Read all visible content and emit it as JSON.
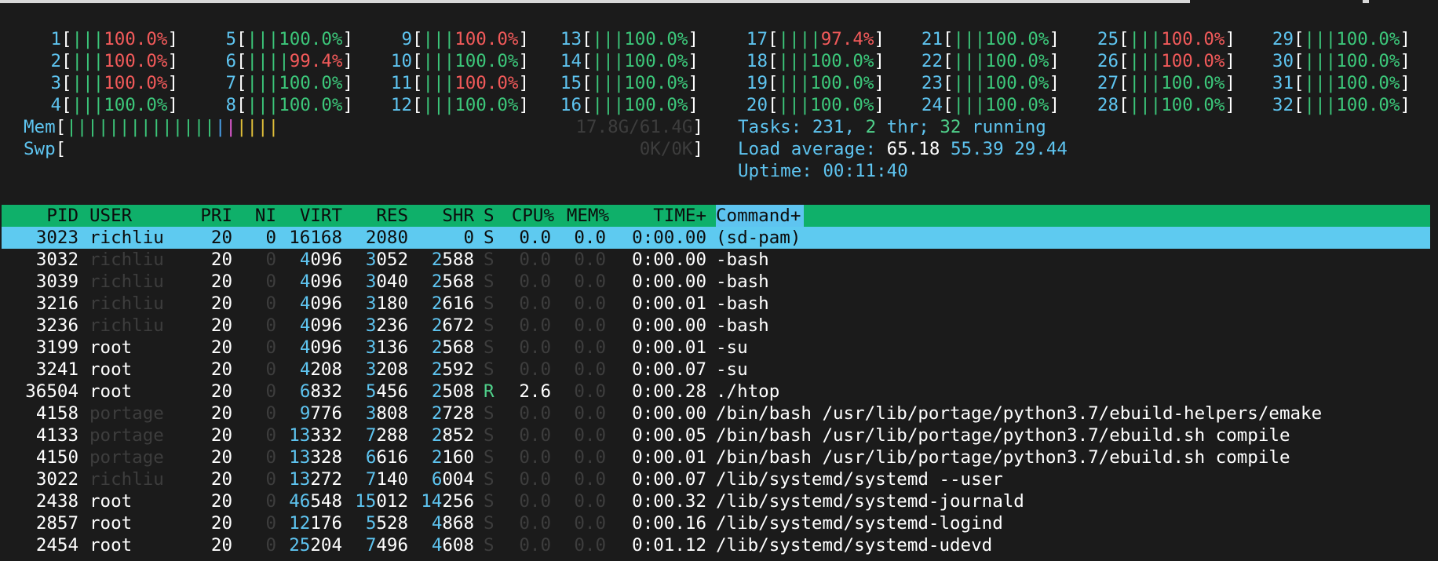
{
  "cpus": [
    {
      "n": "1",
      "bars": "|||",
      "pct": "100.0%"
    },
    {
      "n": "2",
      "bars": "|||",
      "pct": "100.0%"
    },
    {
      "n": "3",
      "bars": "|||",
      "pct": "100.0%"
    },
    {
      "n": "4",
      "bars": "|||",
      "pct": "100.0%"
    },
    {
      "n": "5",
      "bars": "|||",
      "pct": "100.0%"
    },
    {
      "n": "6",
      "bars": "||||",
      "pct": "99.4%"
    },
    {
      "n": "7",
      "bars": "|||",
      "pct": "100.0%"
    },
    {
      "n": "8",
      "bars": "|||",
      "pct": "100.0%"
    },
    {
      "n": "9",
      "bars": "|||",
      "pct": "100.0%"
    },
    {
      "n": "10",
      "bars": "|||",
      "pct": "100.0%"
    },
    {
      "n": "11",
      "bars": "|||",
      "pct": "100.0%"
    },
    {
      "n": "12",
      "bars": "|||",
      "pct": "100.0%"
    },
    {
      "n": "13",
      "bars": "|||",
      "pct": "100.0%"
    },
    {
      "n": "14",
      "bars": "|||",
      "pct": "100.0%"
    },
    {
      "n": "15",
      "bars": "|||",
      "pct": "100.0%"
    },
    {
      "n": "16",
      "bars": "|||",
      "pct": "100.0%"
    },
    {
      "n": "17",
      "bars": "||||",
      "pct": "97.4%"
    },
    {
      "n": "18",
      "bars": "|||",
      "pct": "100.0%"
    },
    {
      "n": "19",
      "bars": "|||",
      "pct": "100.0%"
    },
    {
      "n": "20",
      "bars": "|||",
      "pct": "100.0%"
    },
    {
      "n": "21",
      "bars": "|||",
      "pct": "100.0%"
    },
    {
      "n": "22",
      "bars": "|||",
      "pct": "100.0%"
    },
    {
      "n": "23",
      "bars": "|||",
      "pct": "100.0%"
    },
    {
      "n": "24",
      "bars": "|||",
      "pct": "100.0%"
    },
    {
      "n": "25",
      "bars": "|||",
      "pct": "100.0%"
    },
    {
      "n": "26",
      "bars": "|||",
      "pct": "100.0%"
    },
    {
      "n": "27",
      "bars": "|||",
      "pct": "100.0%"
    },
    {
      "n": "28",
      "bars": "|||",
      "pct": "100.0%"
    },
    {
      "n": "29",
      "bars": "|||",
      "pct": "100.0%"
    },
    {
      "n": "30",
      "bars": "|||",
      "pct": "100.0%"
    },
    {
      "n": "31",
      "bars": "|||",
      "pct": "100.0%"
    },
    {
      "n": "32",
      "bars": "|||",
      "pct": "100.0%"
    }
  ],
  "mem": {
    "label": "Mem",
    "bars_green": "||||||||||||||",
    "bars_blue": "|",
    "bars_magenta": "|",
    "bars_yellow": "||||",
    "value": "17.8G/61.4G"
  },
  "swp": {
    "label": "Swp",
    "value": "0K/0K"
  },
  "summary": {
    "tasks_label": "Tasks:",
    "tasks_count": "231,",
    "threads": "2",
    "threads_label": "thr;",
    "running": "32",
    "running_label": "running",
    "load_label": "Load average:",
    "load1": "65.18",
    "load5": "55.39",
    "load15": "29.44",
    "uptime_label": "Uptime:",
    "uptime": "00:11:40"
  },
  "columns": {
    "pid": "PID",
    "user": "USER",
    "pri": "PRI",
    "ni": "NI",
    "virt": "VIRT",
    "res": "RES",
    "shr": "SHR",
    "s": "S",
    "cpu": "CPU%",
    "mem": "MEM%",
    "time": "TIME+",
    "command": "Command+"
  },
  "processes": [
    {
      "pid": "3023",
      "user": "richliu",
      "pri": "20",
      "ni": "0",
      "virt": "16168",
      "res": "2080",
      "shr": "0",
      "s": "S",
      "cpu": "0.0",
      "mem": "0.0",
      "time": "0:00.00",
      "command": "(sd-pam)"
    },
    {
      "pid": "3032",
      "user": "richliu",
      "pri": "20",
      "ni": "0",
      "virt": "4096",
      "res": "3052",
      "shr": "2588",
      "s": "S",
      "cpu": "0.0",
      "mem": "0.0",
      "time": "0:00.00",
      "command": "-bash"
    },
    {
      "pid": "3039",
      "user": "richliu",
      "pri": "20",
      "ni": "0",
      "virt": "4096",
      "res": "3040",
      "shr": "2568",
      "s": "S",
      "cpu": "0.0",
      "mem": "0.0",
      "time": "0:00.00",
      "command": "-bash"
    },
    {
      "pid": "3216",
      "user": "richliu",
      "pri": "20",
      "ni": "0",
      "virt": "4096",
      "res": "3180",
      "shr": "2616",
      "s": "S",
      "cpu": "0.0",
      "mem": "0.0",
      "time": "0:00.01",
      "command": "-bash"
    },
    {
      "pid": "3236",
      "user": "richliu",
      "pri": "20",
      "ni": "0",
      "virt": "4096",
      "res": "3236",
      "shr": "2672",
      "s": "S",
      "cpu": "0.0",
      "mem": "0.0",
      "time": "0:00.00",
      "command": "-bash"
    },
    {
      "pid": "3199",
      "user": "root",
      "pri": "20",
      "ni": "0",
      "virt": "4096",
      "res": "3136",
      "shr": "2568",
      "s": "S",
      "cpu": "0.0",
      "mem": "0.0",
      "time": "0:00.01",
      "command": "-su"
    },
    {
      "pid": "3241",
      "user": "root",
      "pri": "20",
      "ni": "0",
      "virt": "4208",
      "res": "3208",
      "shr": "2592",
      "s": "S",
      "cpu": "0.0",
      "mem": "0.0",
      "time": "0:00.07",
      "command": "-su"
    },
    {
      "pid": "36504",
      "user": "root",
      "pri": "20",
      "ni": "0",
      "virt": "6832",
      "res": "5456",
      "shr": "2508",
      "s": "R",
      "cpu": "2.6",
      "mem": "0.0",
      "time": "0:00.28",
      "command": "./htop"
    },
    {
      "pid": "4158",
      "user": "portage",
      "pri": "20",
      "ni": "0",
      "virt": "9776",
      "res": "3808",
      "shr": "2728",
      "s": "S",
      "cpu": "0.0",
      "mem": "0.0",
      "time": "0:00.00",
      "command": "/bin/bash /usr/lib/portage/python3.7/ebuild-helpers/emake"
    },
    {
      "pid": "4133",
      "user": "portage",
      "pri": "20",
      "ni": "0",
      "virt": "13332",
      "res": "7288",
      "shr": "2852",
      "s": "S",
      "cpu": "0.0",
      "mem": "0.0",
      "time": "0:00.05",
      "command": "/bin/bash /usr/lib/portage/python3.7/ebuild.sh compile"
    },
    {
      "pid": "4150",
      "user": "portage",
      "pri": "20",
      "ni": "0",
      "virt": "13328",
      "res": "6616",
      "shr": "2160",
      "s": "S",
      "cpu": "0.0",
      "mem": "0.0",
      "time": "0:00.01",
      "command": "/bin/bash /usr/lib/portage/python3.7/ebuild.sh compile"
    },
    {
      "pid": "3022",
      "user": "richliu",
      "pri": "20",
      "ni": "0",
      "virt": "13272",
      "res": "7140",
      "shr": "6004",
      "s": "S",
      "cpu": "0.0",
      "mem": "0.0",
      "time": "0:00.07",
      "command": "/lib/systemd/systemd --user"
    },
    {
      "pid": "2438",
      "user": "root",
      "pri": "20",
      "ni": "0",
      "virt": "46548",
      "res": "15012",
      "shr": "14256",
      "s": "S",
      "cpu": "0.0",
      "mem": "0.0",
      "time": "0:00.32",
      "command": "/lib/systemd/systemd-journald"
    },
    {
      "pid": "2857",
      "user": "root",
      "pri": "20",
      "ni": "0",
      "virt": "12176",
      "res": "5528",
      "shr": "4868",
      "s": "S",
      "cpu": "0.0",
      "mem": "0.0",
      "time": "0:00.16",
      "command": "/lib/systemd/systemd-logind"
    },
    {
      "pid": "2454",
      "user": "root",
      "pri": "20",
      "ni": "0",
      "virt": "25204",
      "res": "7496",
      "shr": "4608",
      "s": "S",
      "cpu": "0.0",
      "mem": "0.0",
      "time": "0:01.12",
      "command": "/lib/systemd/systemd-udevd"
    }
  ],
  "colors": {
    "header_bg": "#0fb06a",
    "selected_bg": "#5ecaf0",
    "background": "#1b1b1b"
  }
}
